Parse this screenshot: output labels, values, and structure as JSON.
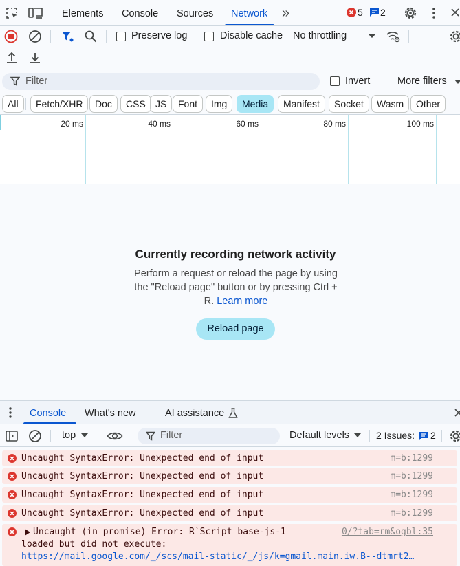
{
  "main_tabs": [
    "Elements",
    "Console",
    "Sources",
    "Network"
  ],
  "active_tab": "Network",
  "more_tabs_glyph": "»",
  "error_count": "5",
  "message_count": "2",
  "network_toolbar": {
    "preserve_log": "Preserve log",
    "disable_cache": "Disable cache",
    "throttling": "No throttling"
  },
  "filter": {
    "placeholder": "Filter",
    "invert": "Invert",
    "more_filters": "More filters"
  },
  "type_chips": [
    "All",
    "Fetch/XHR",
    "Doc",
    "CSS",
    "JS",
    "Font",
    "Img",
    "Media",
    "Manifest",
    "Socket",
    "Wasm",
    "Other"
  ],
  "active_chip": "Media",
  "timeline_ticks": [
    "20 ms",
    "40 ms",
    "60 ms",
    "80 ms",
    "100 ms"
  ],
  "empty_state": {
    "title": "Currently recording network activity",
    "desc_line1": "Perform a request or reload the page by using",
    "desc_line2": "the \"Reload page\" button or by pressing Ctrl +",
    "desc_line3": "R.",
    "learn_more": "Learn more",
    "reload_button": "Reload page"
  },
  "drawer": {
    "tabs": [
      "Console",
      "What's new",
      "AI assistance"
    ],
    "active": "Console",
    "context": "top",
    "filter_placeholder": "Filter",
    "levels": "Default levels",
    "issues_label": "2 Issues:",
    "issues_count": "2"
  },
  "messages": [
    {
      "text": "Uncaught SyntaxError: Unexpected end of input",
      "source": "m=b:1299"
    },
    {
      "text": "Uncaught SyntaxError: Unexpected end of input",
      "source": "m=b:1299"
    },
    {
      "text": "Uncaught SyntaxError: Unexpected end of input",
      "source": "m=b:1299"
    },
    {
      "text": "Uncaught SyntaxError: Unexpected end of input",
      "source": "m=b:1299"
    }
  ],
  "promise_error": {
    "line1": "Uncaught (in promise) Error: R`Script base-js-1",
    "source": "0/?tab=rm&ogbl:35",
    "line2": "loaded but did not execute:",
    "url": "https://mail.google.com/_/scs/mail-static/_/js/k=gmail.main.iw.B--dtmrt2…"
  },
  "colors": {
    "accent": "#0b57d0",
    "error": "#dc362e",
    "chip_active": "#a8e6f5",
    "error_row_bg": "#fce8e6"
  }
}
